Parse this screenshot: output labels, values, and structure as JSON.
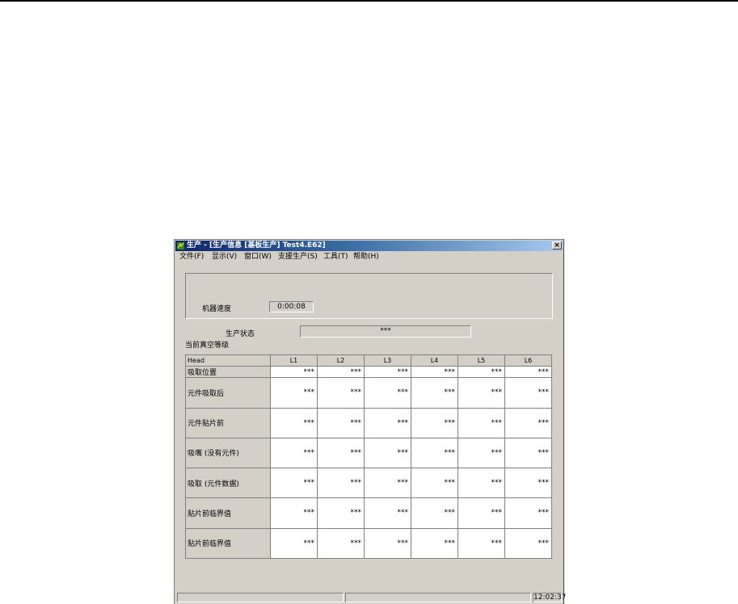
{
  "window": {
    "title": "生产 - [生产信息 [基板生产] Test4.E62]"
  },
  "menu": [
    "文件(F)",
    "显示(V)",
    "窗口(W)",
    "支援生产(S)",
    "工具(T)",
    "帮助(H)"
  ],
  "machine_speed": {
    "label": "机器速度",
    "value": "0:00:08"
  },
  "production_status": {
    "label": "生产状态",
    "value": "***"
  },
  "vacuum_label": "当前真空等级",
  "table": {
    "headers": [
      "Head",
      "L1",
      "L2",
      "L3",
      "L4",
      "L5",
      "L6"
    ],
    "rows": [
      {
        "label": "吸取位置",
        "values": [
          "***",
          "***",
          "***",
          "***",
          "***",
          "***"
        ]
      },
      {
        "label": "元件吸取后",
        "values": [
          "***",
          "***",
          "***",
          "***",
          "***",
          "***"
        ]
      },
      {
        "label": "元件贴片前",
        "values": [
          "***",
          "***",
          "***",
          "***",
          "***",
          "***"
        ]
      },
      {
        "label": "吸嘴 (没有元件)",
        "values": [
          "***",
          "***",
          "***",
          "***",
          "***",
          "***"
        ]
      },
      {
        "label": "吸取 (元件数据)",
        "values": [
          "***",
          "***",
          "***",
          "***",
          "***",
          "***"
        ]
      },
      {
        "label": "贴片前临界值",
        "values": [
          "***",
          "***",
          "***",
          "***",
          "***",
          "***"
        ]
      },
      {
        "label": "贴片前临界值",
        "values": [
          "***",
          "***",
          "***",
          "***",
          "***",
          "***"
        ]
      }
    ]
  },
  "statusbar": {
    "time": "12:02:37"
  }
}
